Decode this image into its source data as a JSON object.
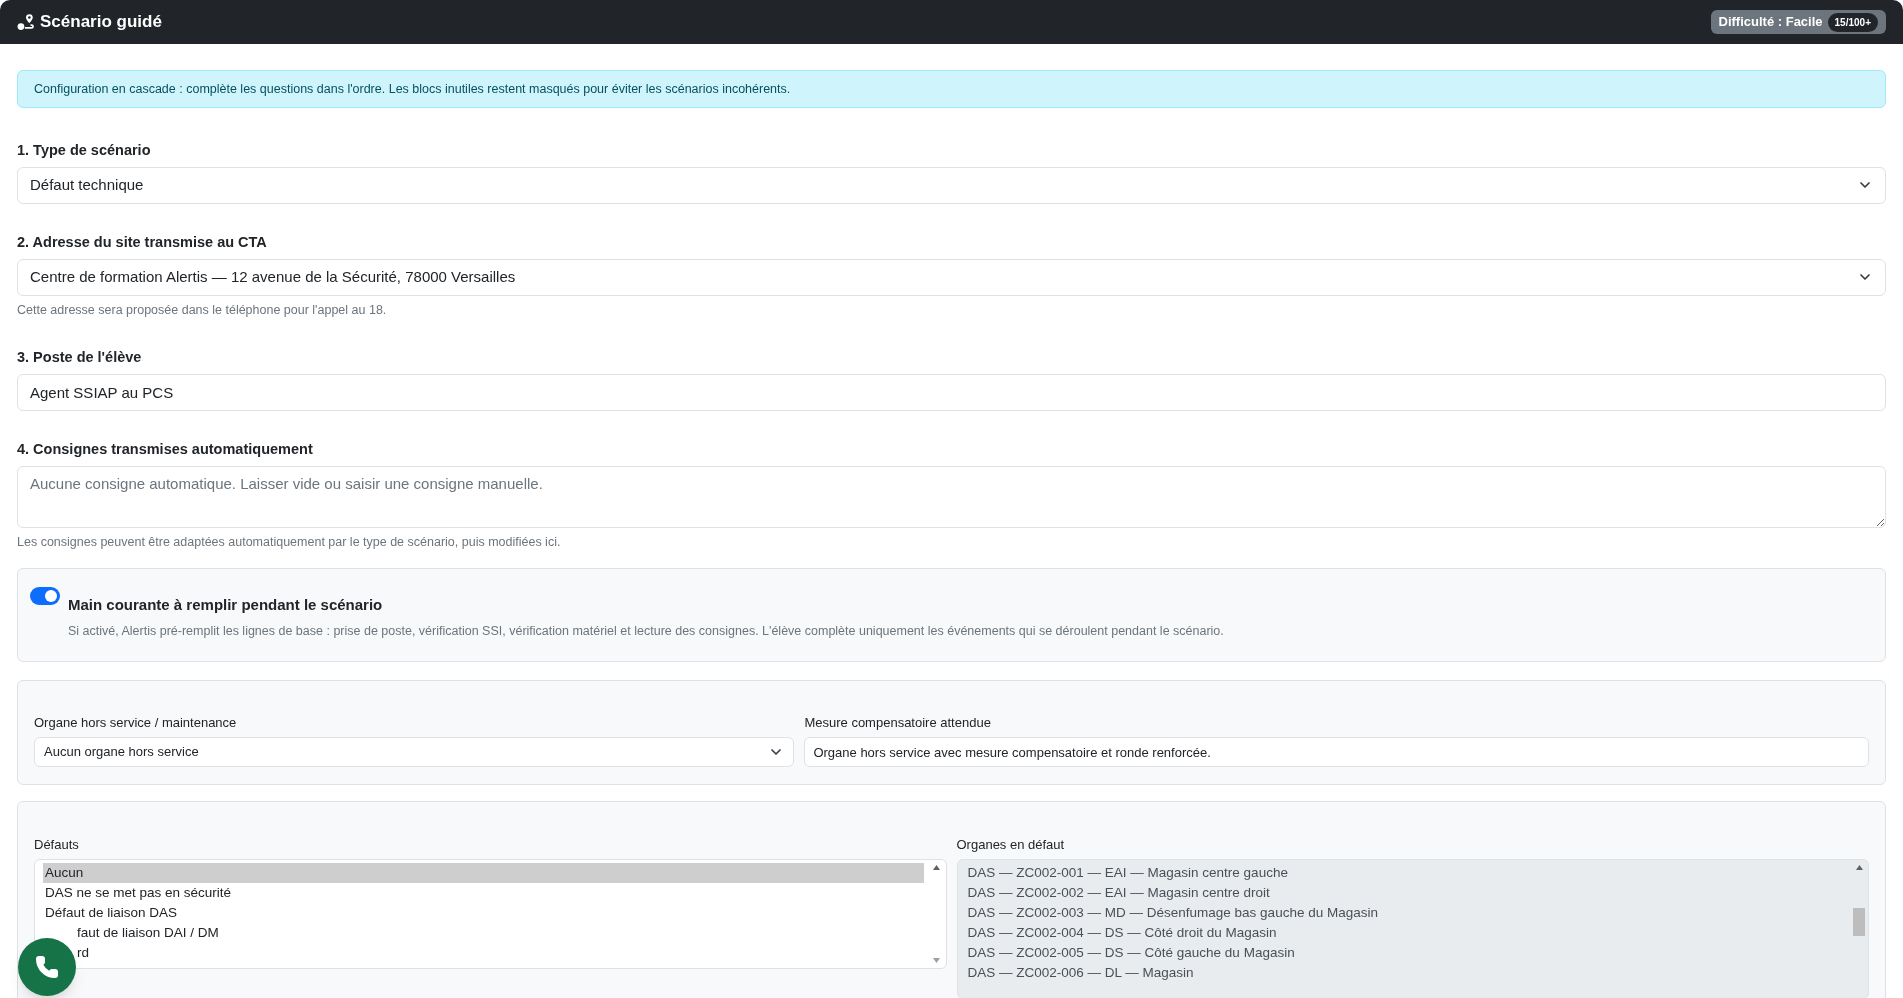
{
  "header": {
    "title": "Scénario guidé",
    "difficulty": "Difficulté : Facile",
    "score": "15/100+"
  },
  "alert": "Configuration en cascade : complète les questions dans l'ordre. Les blocs inutiles restent masqués pour éviter les scénarios incohérents.",
  "fields": [
    {
      "kind": "select",
      "label": "1. Type de scénario",
      "value": "Défaut technique"
    },
    {
      "kind": "select",
      "label": "2. Adresse du site transmise au CTA",
      "value": "Centre de formation Alertis — 12 avenue de la Sécurité, 78000 Versailles",
      "help": "Cette adresse sera proposée dans le téléphone pour l'appel au 18."
    },
    {
      "kind": "input",
      "label": "3. Poste de l'élève",
      "value": "Agent SSIAP au PCS"
    },
    {
      "kind": "textarea",
      "label": "4. Consignes transmises automatiquement",
      "placeholder": "Aucune consigne automatique. Laisser vide ou saisir une consigne manuelle.",
      "help": "Les consignes peuvent être adaptées automatiquement par le type de scénario, puis modifiées ici."
    }
  ],
  "main_courante": {
    "on": true,
    "title": "Main courante à remplir pendant le scénario",
    "description": "Si activé, Alertis pré-remplit les lignes de base : prise de poste, vérification SSI, vérification matériel et lecture des consignes. L'élève complète uniquement les événements qui se déroulent pendant le scénario."
  },
  "maintenance": {
    "organ_label": "Organe hors service / maintenance",
    "organ_value": "Aucun organe hors service",
    "measure_label": "Mesure compensatoire attendue",
    "measure_value": "Organe hors service avec mesure compensatoire et ronde renforcée."
  },
  "defauts": {
    "label": "Défauts",
    "items": [
      {
        "text": "Aucun",
        "selected": true
      },
      {
        "text": "DAS ne se met pas en sécurité",
        "selected": false
      },
      {
        "text": "Défaut de liaison DAS",
        "selected": false
      },
      {
        "text": "faut de liaison DAI / DM",
        "selected": false,
        "covered": true
      },
      {
        "text": "rd",
        "selected": false,
        "covered": true
      }
    ]
  },
  "organes": {
    "label": "Organes en défaut",
    "items": [
      {
        "text": "DAS — ZC002-001 — EAI — Magasin centre gauche",
        "selected": false
      },
      {
        "text": "DAS — ZC002-002 — EAI — Magasin centre droit",
        "selected": false
      },
      {
        "text": "DAS — ZC002-003 — MD — Désenfumage bas gauche du Magasin",
        "selected": false
      },
      {
        "text": "DAS — ZC002-004 — DS — Côté droit du Magasin",
        "selected": false
      },
      {
        "text": "DAS — ZC002-005 — DS — Côté gauche du Magasin",
        "selected": false
      },
      {
        "text": "DAS — ZC002-006 — DL — Magasin",
        "selected": false
      }
    ]
  }
}
